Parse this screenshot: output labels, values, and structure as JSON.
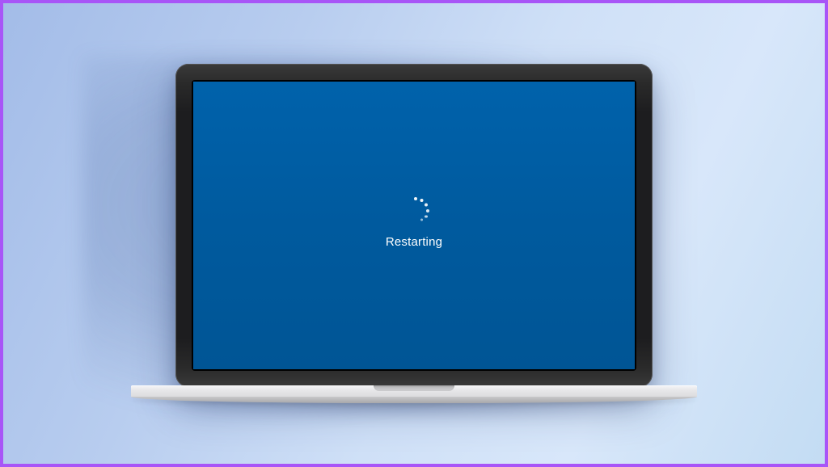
{
  "screen": {
    "status_text": "Restarting",
    "background_color": "#005A9E"
  },
  "frame": {
    "border_color": "#a855f7"
  }
}
